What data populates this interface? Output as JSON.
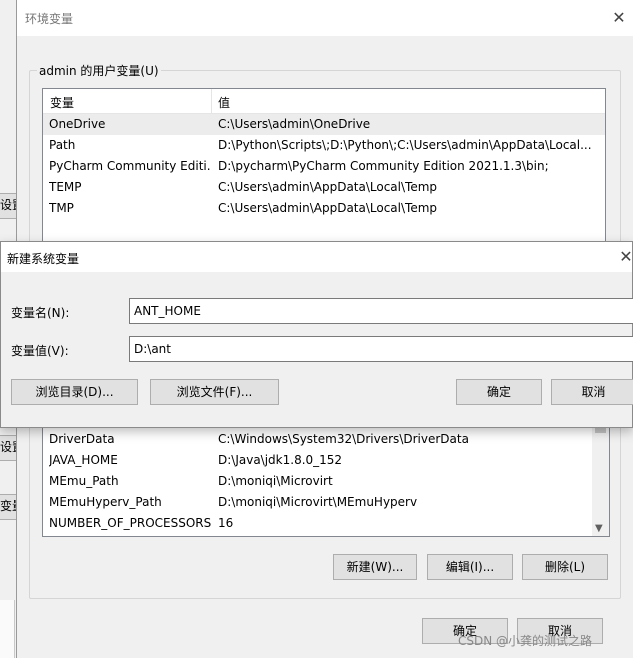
{
  "background": {
    "left_fragments": [
      "设置",
      "设置",
      "变量"
    ]
  },
  "env_window": {
    "title": "环境变量",
    "user_group_label": "admin 的用户变量(U)",
    "columns": {
      "name": "变量",
      "value": "值"
    },
    "user_vars": [
      {
        "name": "OneDrive",
        "value": "C:\\Users\\admin\\OneDrive"
      },
      {
        "name": "Path",
        "value": "D:\\Python\\Scripts\\;D:\\Python\\;C:\\Users\\admin\\AppData\\Local..."
      },
      {
        "name": "PyCharm Community Editi...",
        "value": "D:\\pycharm\\PyCharm Community Edition 2021.1.3\\bin;"
      },
      {
        "name": "TEMP",
        "value": "C:\\Users\\admin\\AppData\\Local\\Temp"
      },
      {
        "name": "TMP",
        "value": "C:\\Users\\admin\\AppData\\Local\\Temp"
      }
    ],
    "system_vars": [
      {
        "name": "DriverData",
        "value": "C:\\Windows\\System32\\Drivers\\DriverData"
      },
      {
        "name": "JAVA_HOME",
        "value": "D:\\Java\\jdk1.8.0_152"
      },
      {
        "name": "MEmu_Path",
        "value": "D:\\moniqi\\Microvirt"
      },
      {
        "name": "MEmuHyperv_Path",
        "value": "D:\\moniqi\\Microvirt\\MEmuHyperv"
      },
      {
        "name": "NUMBER_OF_PROCESSORS",
        "value": "16"
      }
    ],
    "system_buttons": {
      "new": "新建(W)...",
      "edit": "编辑(I)...",
      "delete": "删除(L)"
    },
    "ok": "确定",
    "cancel": "取消"
  },
  "new_var_dialog": {
    "title": "新建系统变量",
    "name_label": "变量名(N):",
    "value_label": "变量值(V):",
    "name_value": "ANT_HOME",
    "value_value": "D:\\ant",
    "browse_dir": "浏览目录(D)...",
    "browse_file": "浏览文件(F)...",
    "ok": "确定",
    "cancel": "取消"
  },
  "watermark": "CSDN @小龚的测试之路"
}
